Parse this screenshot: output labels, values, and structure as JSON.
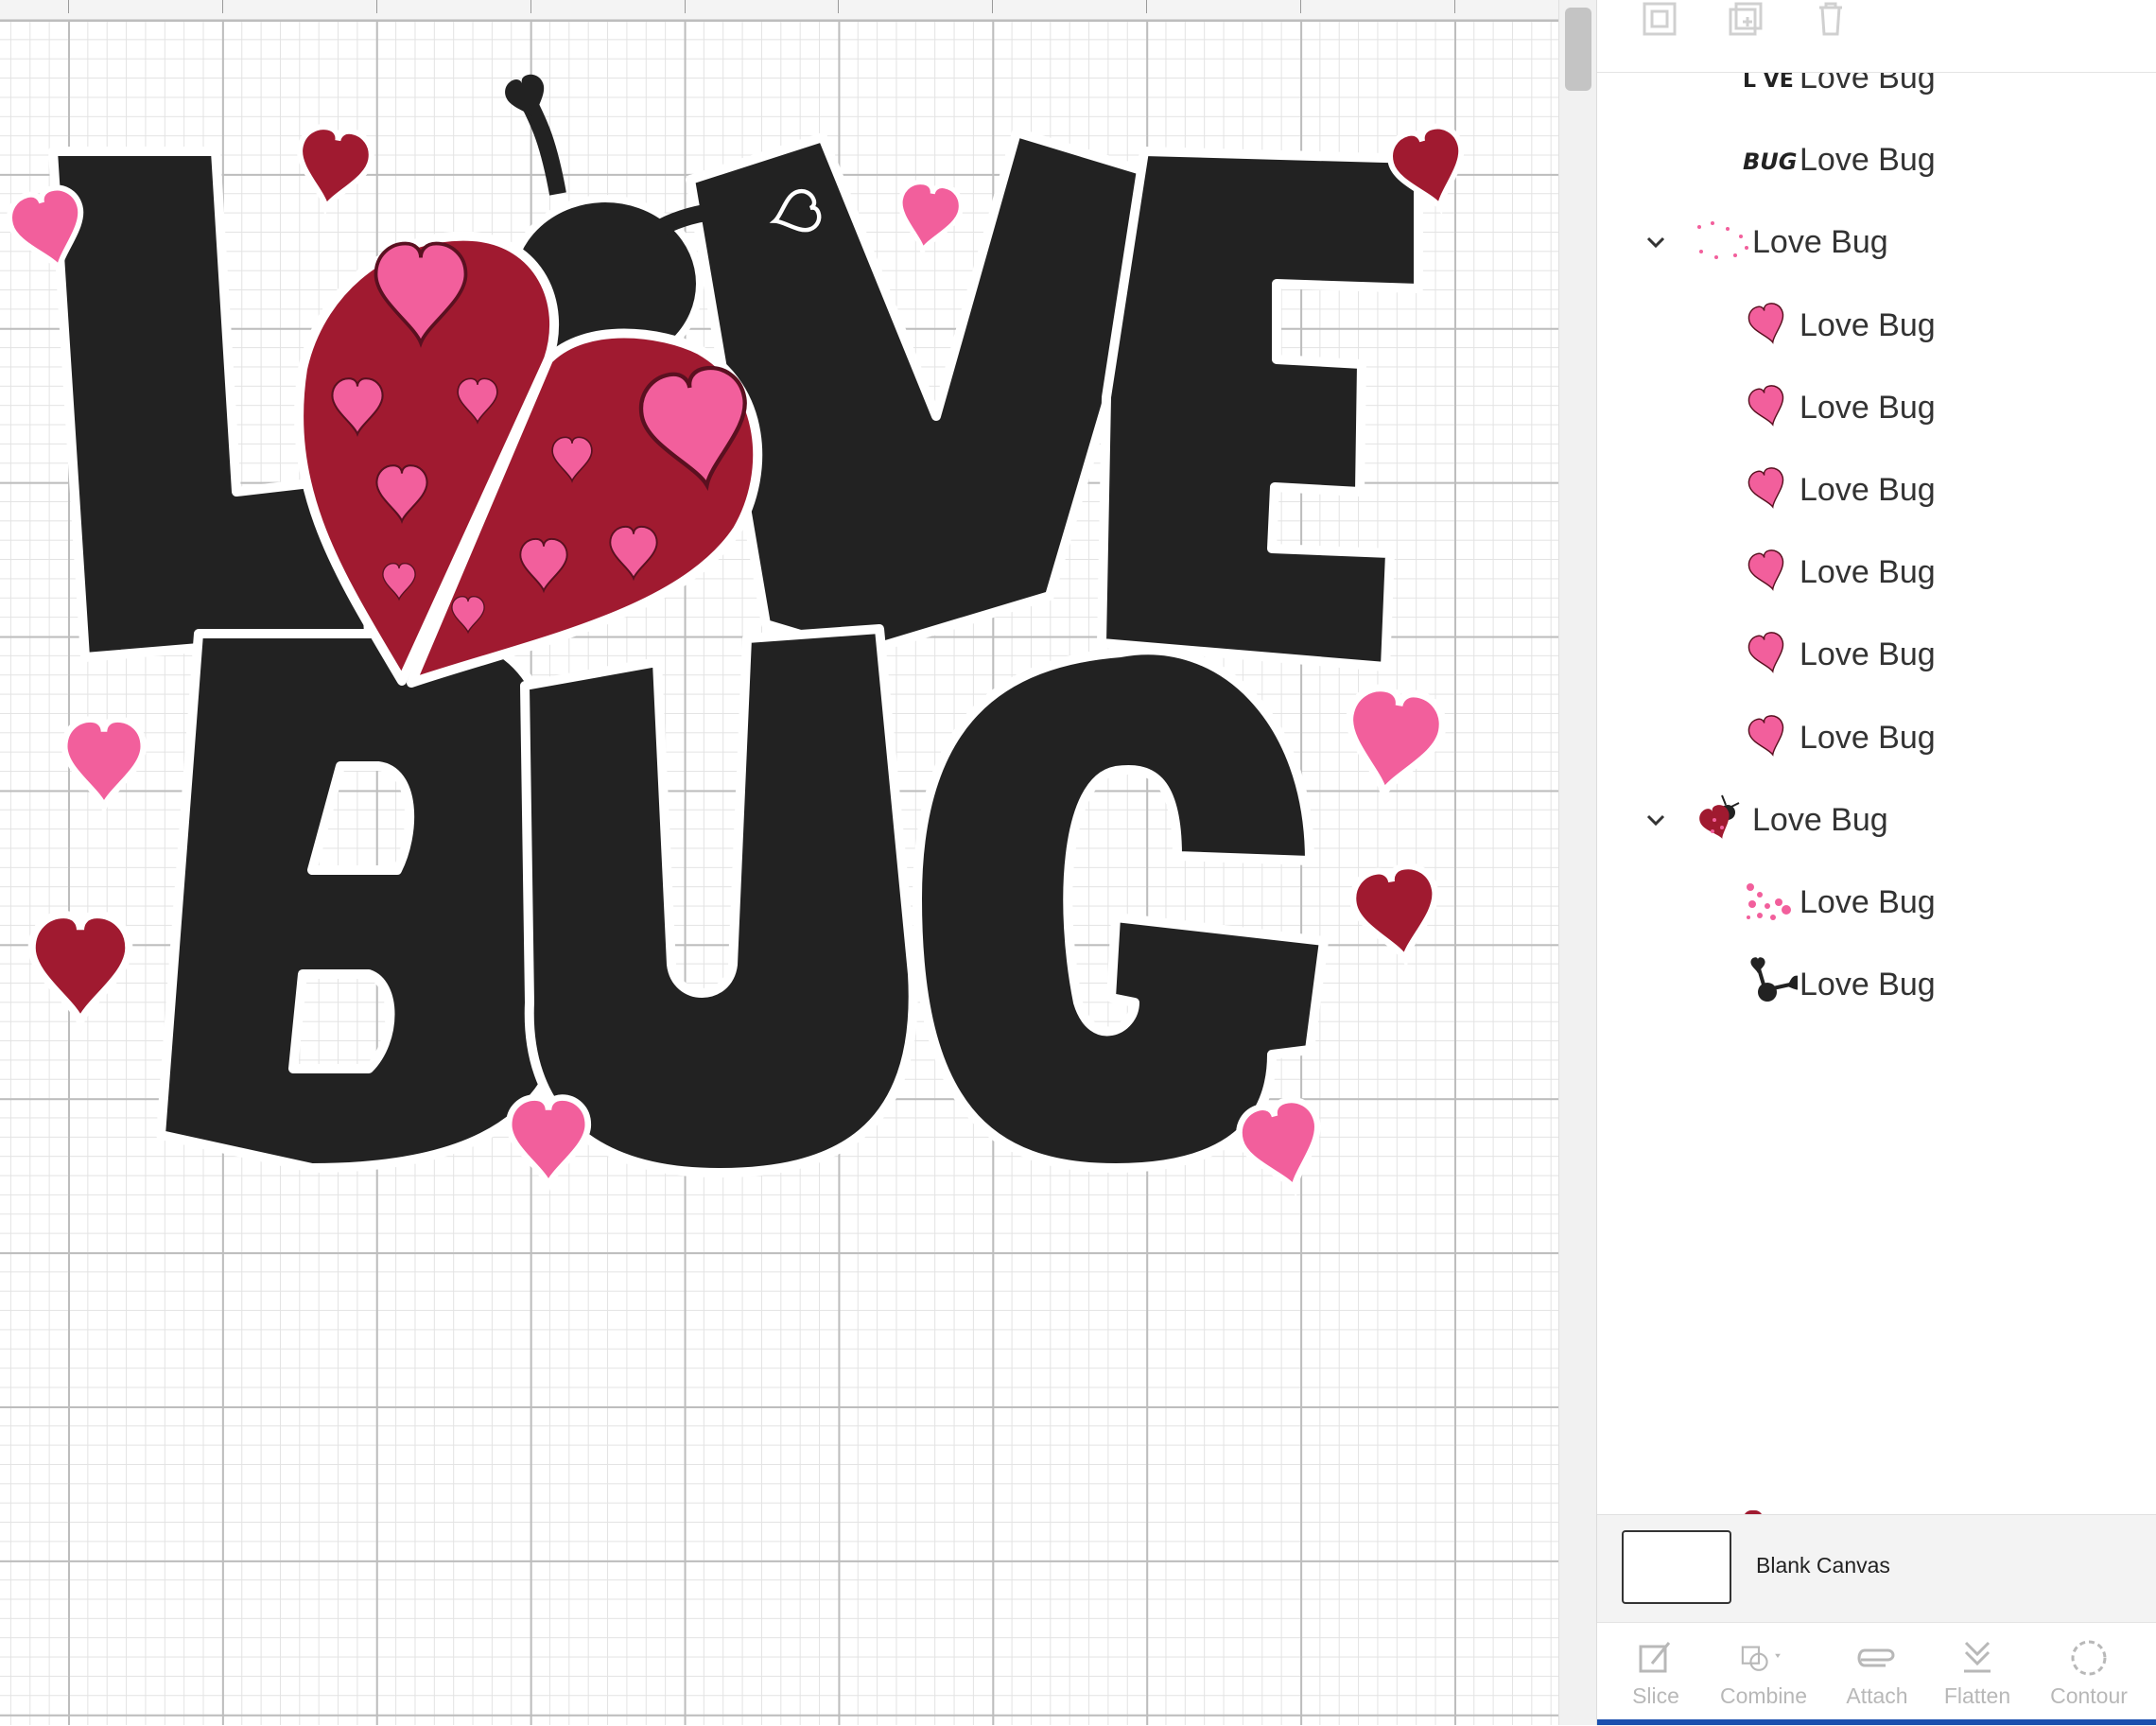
{
  "colors": {
    "accent": "#1a4fae",
    "letter_black": "#222222",
    "heart_pink": "#f25f9c",
    "heart_red": "#a01a30",
    "disabled": "#b8b8b8"
  },
  "canvas": {
    "design_name": "Love Bug"
  },
  "layers_panel": {
    "top_toolbar": {
      "group_icon": "group-icon",
      "duplicate_icon": "duplicate-icon",
      "delete_icon": "delete-icon"
    },
    "items": [
      {
        "label": "Love Bug",
        "thumb": "love-letters",
        "indent": 2,
        "expanded": null
      },
      {
        "label": "Love Bug",
        "thumb": "bug-letters",
        "indent": 2,
        "expanded": null
      },
      {
        "label": "Love Bug",
        "thumb": "dots-group",
        "indent": 1,
        "expanded": true
      },
      {
        "label": "Love Bug",
        "thumb": "pink-heart",
        "indent": 2,
        "expanded": null
      },
      {
        "label": "Love Bug",
        "thumb": "pink-heart",
        "indent": 2,
        "expanded": null
      },
      {
        "label": "Love Bug",
        "thumb": "pink-heart",
        "indent": 2,
        "expanded": null
      },
      {
        "label": "Love Bug",
        "thumb": "pink-heart",
        "indent": 2,
        "expanded": null
      },
      {
        "label": "Love Bug",
        "thumb": "pink-heart",
        "indent": 2,
        "expanded": null
      },
      {
        "label": "Love Bug",
        "thumb": "pink-heart",
        "indent": 2,
        "expanded": null
      },
      {
        "label": "Love Bug",
        "thumb": "ladybug",
        "indent": 1,
        "expanded": true
      },
      {
        "label": "Love Bug",
        "thumb": "pink-dots",
        "indent": 2,
        "expanded": null
      },
      {
        "label": "Love Bug",
        "thumb": "antenna",
        "indent": 2,
        "expanded": null
      }
    ],
    "blank_canvas": {
      "label": "Blank Canvas"
    },
    "bottom_toolbar": [
      {
        "label": "Slice",
        "icon": "slice-icon"
      },
      {
        "label": "Combine",
        "icon": "combine-icon"
      },
      {
        "label": "Attach",
        "icon": "attach-icon"
      },
      {
        "label": "Flatten",
        "icon": "flatten-icon"
      },
      {
        "label": "Contour",
        "icon": "contour-icon"
      }
    ]
  }
}
